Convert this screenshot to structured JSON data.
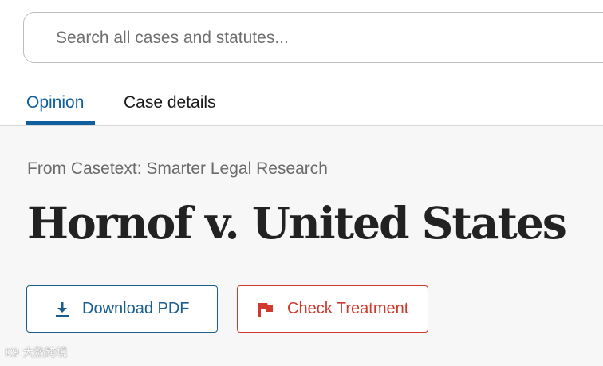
{
  "search": {
    "placeholder": "Search all cases and statutes..."
  },
  "tabs": [
    {
      "label": "Opinion",
      "active": true
    },
    {
      "label": "Case details",
      "active": false
    }
  ],
  "source_label": "From Casetext: Smarter Legal Research",
  "case_title": "Hornof v. United States",
  "actions": {
    "download_label": "Download PDF",
    "download_icon": "download-icon",
    "treatment_label": "Check Treatment",
    "treatment_icon": "flag-icon"
  },
  "watermark": {
    "text": "K9 大数跨境"
  },
  "colors": {
    "accent_blue": "#0f5f9e",
    "download_blue": "#1a5e8f",
    "treatment_red": "#d0392e",
    "title_text": "#222222",
    "content_bg": "#f7f7f7"
  }
}
